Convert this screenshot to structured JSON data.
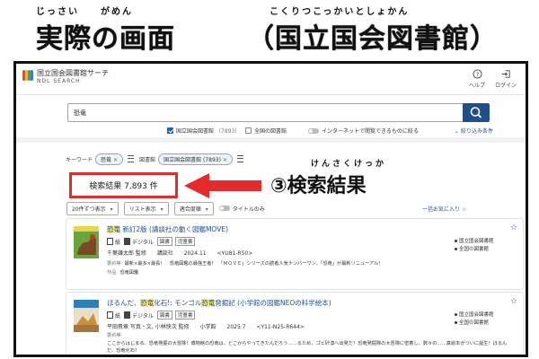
{
  "banner": {
    "left_title": "実際の画面",
    "left_ruby": "じっさい　　がめん",
    "right_title": "（国立国会図書館）",
    "right_ruby": "こくりつこっかいとしょかん"
  },
  "header": {
    "logo_ja": "国立国会図書館サーチ",
    "logo_en": "NDL SEARCH",
    "help_label": "ヘルプ",
    "login_label": "ログイン",
    "logo_colors": [
      "#e94b3c",
      "#f2b431",
      "#37a55a",
      "#3a7bd5"
    ]
  },
  "search": {
    "query": "恐竜",
    "options": {
      "ndl_label": "国立国会図書館",
      "ndl_count": "（7893）",
      "ndl_checked": true,
      "all_libraries_label": "全国の図書館",
      "all_libraries_checked": false,
      "online_label": "インターネットで閲覧できるものに絞る",
      "narrow_label": "絞り込み条件"
    }
  },
  "filters": {
    "keyword_label": "キーワード",
    "keyword_chip": "恐竜",
    "library_label": "図書館",
    "library_chip": "国立国会図書館 (7893)"
  },
  "results": {
    "count_text": "検索結果 7,893 件",
    "highlight_color": "#e42b2b",
    "callout": "③検索結果",
    "callout_ruby": "けんさくけっか",
    "per_page": "20件ずつ表示",
    "view_mode": "リスト表示",
    "sort": "適合度順",
    "title_only": "タイトルのみ",
    "bookmark_all": "一括お気に入り"
  },
  "items": [
    {
      "title_hl": "恐竜",
      "title_rest": " 新訂2版 (講談社の動く図鑑MOVE)",
      "media": [
        "紙",
        "デジタル"
      ],
      "types": [
        "図書",
        "児童書"
      ],
      "author": "千葉謙太郎 監修",
      "publisher": "講談社",
      "date": "2024.11",
      "call_no": "<YU81-R50>",
      "summary_key": "要約等",
      "summary": "最新×最多×最長！　恐竜図鑑の最強王者！　「ＭＯＶＥ」シリーズの読者人気ナンバーワン、「恐竜」が最新リニューアル！",
      "work_key": "作品",
      "work": "恐竜図鑑",
      "holdings": [
        "国立国会図書館",
        "全国の図書館"
      ]
    },
    {
      "title_pre": "ほるんだ、",
      "title_hl": "恐竜",
      "title_mid": "化石!: モンゴル",
      "title_hl2": "恐竜",
      "title_rest": "発掘記 (小学館の図鑑NEOの科学絵本)",
      "media": [
        "紙",
        "デジタル"
      ],
      "types": [
        "図書",
        "児童書"
      ],
      "author": "平田貴章 写真・文, 小林快次 監修",
      "publisher": "小学館",
      "date": "2025.7",
      "call_no": "<Y11-N25-R644>",
      "summary_key": "要約等",
      "summary": "ここからはじまる、恐竜発掘の大冒険！博物館の恐竜は、どこからやってきたんだろう……るため、ゴビ砂漠へ出発だ！恐竜発掘隊の大冒険に密着し、数々の……真絵本がついに誕生！ほるんだ、恐竜化石！",
      "holdings": [
        "国立国会図書館",
        "全国の図書館"
      ]
    }
  ]
}
